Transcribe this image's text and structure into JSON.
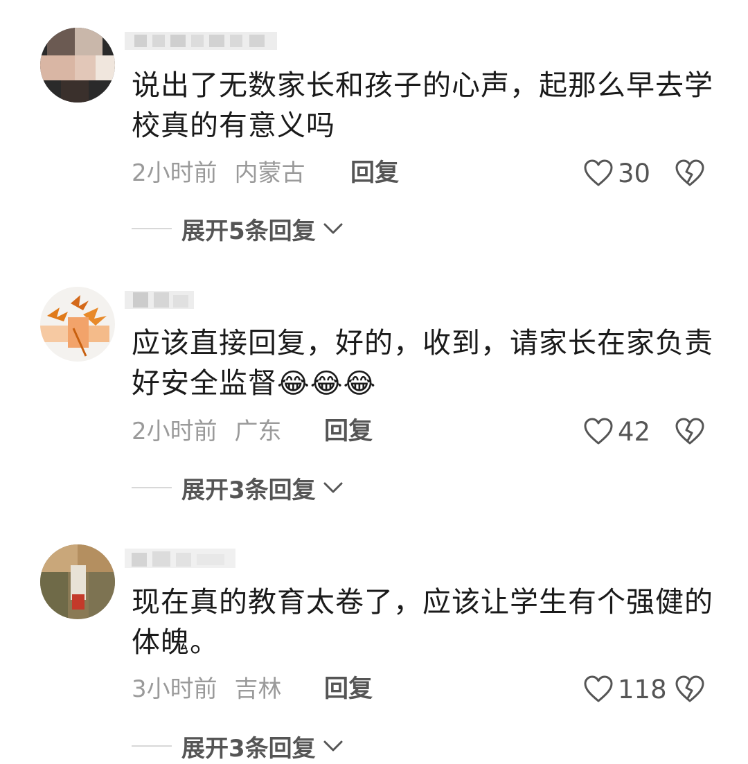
{
  "comments": [
    {
      "text": "说出了无数家长和孩子的心声，起那么早去学校真的有意义吗",
      "time": "2小时前",
      "location": "内蒙古",
      "reply_label": "回复",
      "likes": "30",
      "expand_label": "展开5条回复"
    },
    {
      "text": "应该直接回复，好的，收到，请家长在家负责好安全监督",
      "emoji": "😂😂😂",
      "time": "2小时前",
      "location": "广东",
      "reply_label": "回复",
      "likes": "42",
      "expand_label": "展开3条回复"
    },
    {
      "text": "现在真的教育太卷了，应该让学生有个强健的体魄。",
      "time": "3小时前",
      "location": "吉林",
      "reply_label": "回复",
      "likes": "118",
      "expand_label": "展开3条回复"
    }
  ],
  "icons": {
    "like": "heart-outline-icon",
    "dislike": "broken-heart-icon",
    "expand": "chevron-down-icon"
  },
  "colors": {
    "text": "#1a1a1a",
    "meta": "#9a9a9a",
    "action": "#555555"
  }
}
